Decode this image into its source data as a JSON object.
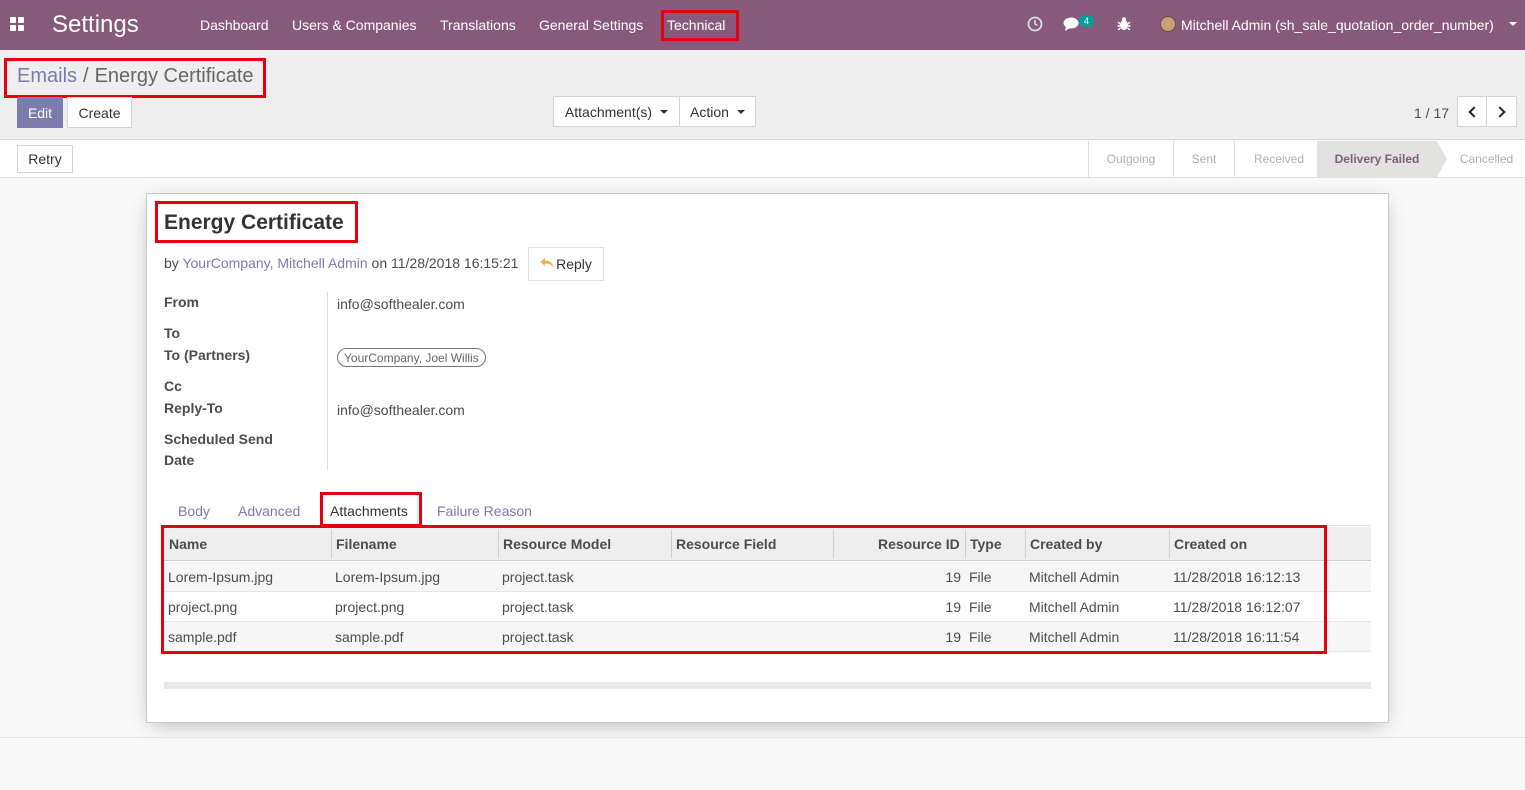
{
  "navbar": {
    "brand": "Settings",
    "menu": [
      "Dashboard",
      "Users & Companies",
      "Translations",
      "General Settings",
      "Technical"
    ],
    "messages_count": "4",
    "user": "Mitchell Admin (sh_sale_quotation_order_number)",
    "color": "#875a7b"
  },
  "breadcrumb": {
    "parent": "Emails",
    "separator": "/",
    "current": "Energy Certificate"
  },
  "actions": {
    "edit": "Edit",
    "create": "Create",
    "attachments": "Attachment(s)",
    "action": "Action"
  },
  "pager": {
    "text": "1 / 17"
  },
  "header": {
    "retry": "Retry",
    "statuses": [
      "Outgoing",
      "Sent",
      "Received",
      "Delivery Failed",
      "Cancelled"
    ],
    "active_status": "Delivery Failed"
  },
  "email": {
    "subject": "Energy Certificate",
    "by_prefix": "by",
    "author": "YourCompany, Mitchell Admin",
    "date_text": "on 11/28/2018 16:15:21",
    "reply": "Reply",
    "fields": {
      "from_label": "From",
      "from_value": "info@softhealer.com",
      "to_label": "To",
      "to_partners_label": "To (Partners)",
      "to_partners_tag": "YourCompany, Joel Willis",
      "cc_label": "Cc",
      "reply_to_label": "Reply-To",
      "reply_to_value": "info@softhealer.com",
      "scheduled_label_1": "Scheduled Send",
      "scheduled_label_2": "Date"
    }
  },
  "tabs": [
    "Body",
    "Advanced",
    "Attachments",
    "Failure Reason"
  ],
  "active_tab": "Attachments",
  "attachments": {
    "columns": [
      "Name",
      "Filename",
      "Resource Model",
      "Resource Field",
      "Resource ID",
      "Type",
      "Created by",
      "Created on"
    ],
    "rows": [
      [
        "Lorem-Ipsum.jpg",
        "Lorem-Ipsum.jpg",
        "project.task",
        "",
        "19",
        "File",
        "Mitchell Admin",
        "11/28/2018 16:12:13"
      ],
      [
        "project.png",
        "project.png",
        "project.task",
        "",
        "19",
        "File",
        "Mitchell Admin",
        "11/28/2018 16:12:07"
      ],
      [
        "sample.pdf",
        "sample.pdf",
        "project.task",
        "",
        "19",
        "File",
        "Mitchell Admin",
        "11/28/2018 16:11:54"
      ]
    ]
  },
  "colors": {
    "accent": "#7c7bad",
    "highlight": "#e3000f"
  }
}
